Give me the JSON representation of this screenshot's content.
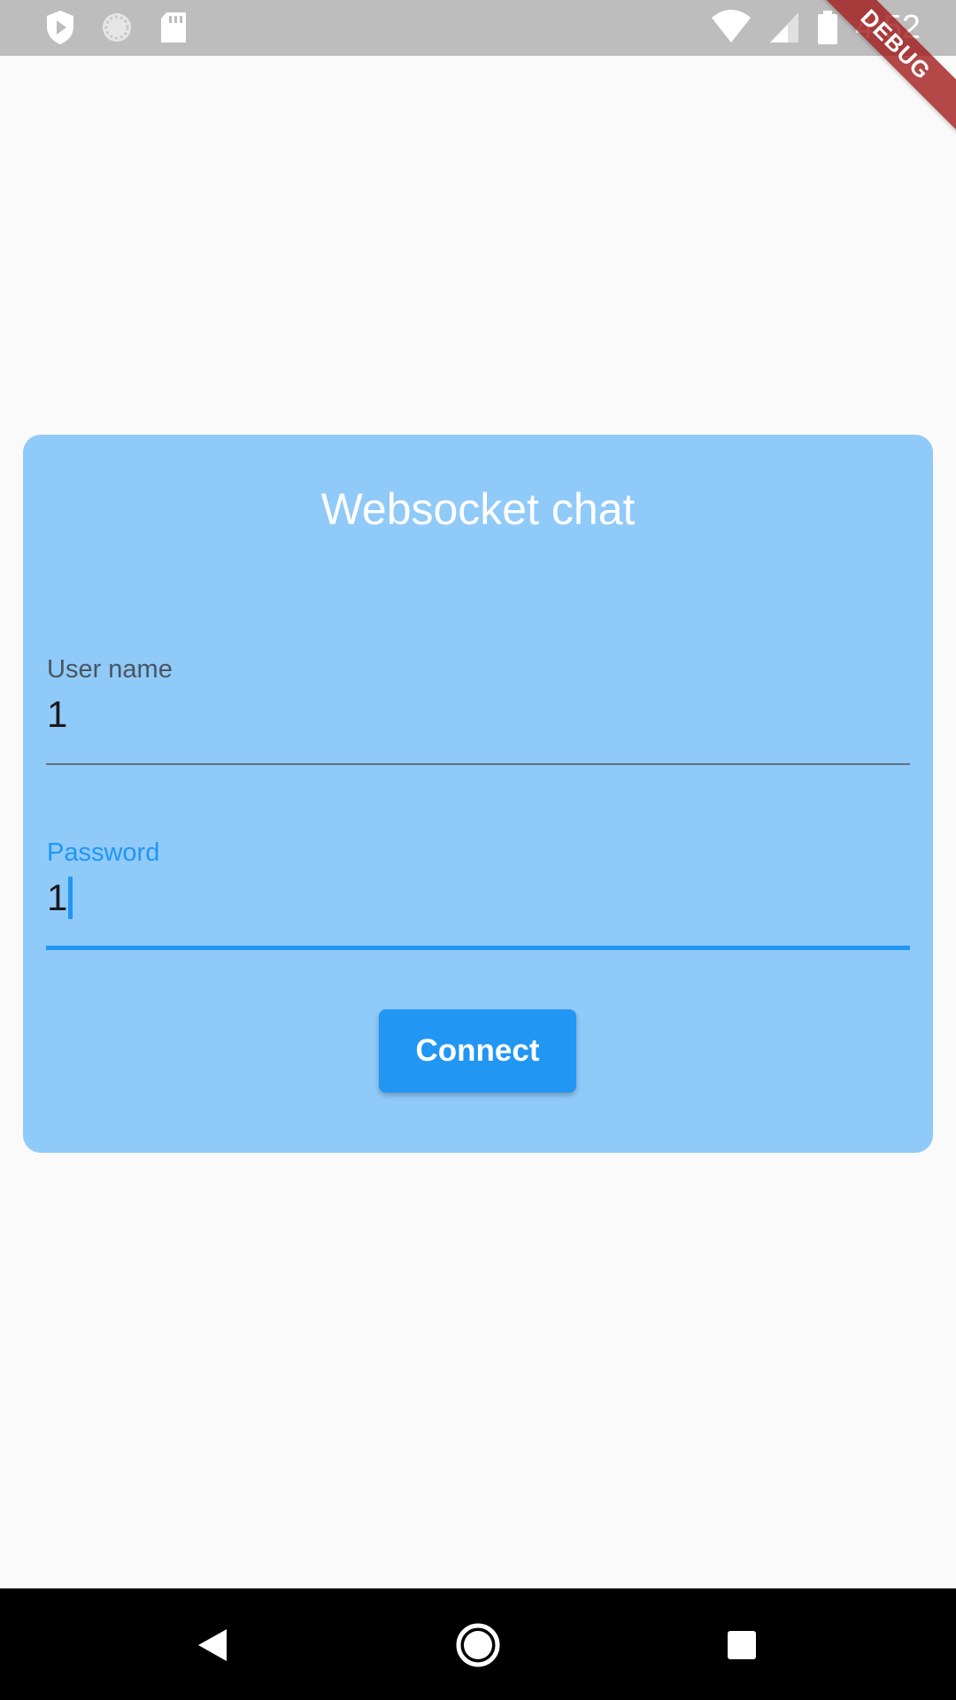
{
  "status_bar": {
    "time": "4:52",
    "left_icons": [
      "play-shield-icon",
      "sync-circle-icon",
      "sd-card-icon"
    ],
    "right_icons": [
      "wifi-icon",
      "cell-signal-icon",
      "battery-icon"
    ]
  },
  "debug_banner": "DEBUG",
  "card": {
    "title": "Websocket chat",
    "background": "#90caf9",
    "username": {
      "label": "User name",
      "value": "1"
    },
    "password": {
      "label": "Password",
      "value": "1"
    },
    "connect_label": "Connect"
  },
  "colors": {
    "accent": "#2196f3",
    "card": "#90caf9",
    "page": "#fafafa"
  },
  "nav_bar": {
    "buttons": [
      "back-icon",
      "home-icon",
      "recents-icon"
    ]
  }
}
